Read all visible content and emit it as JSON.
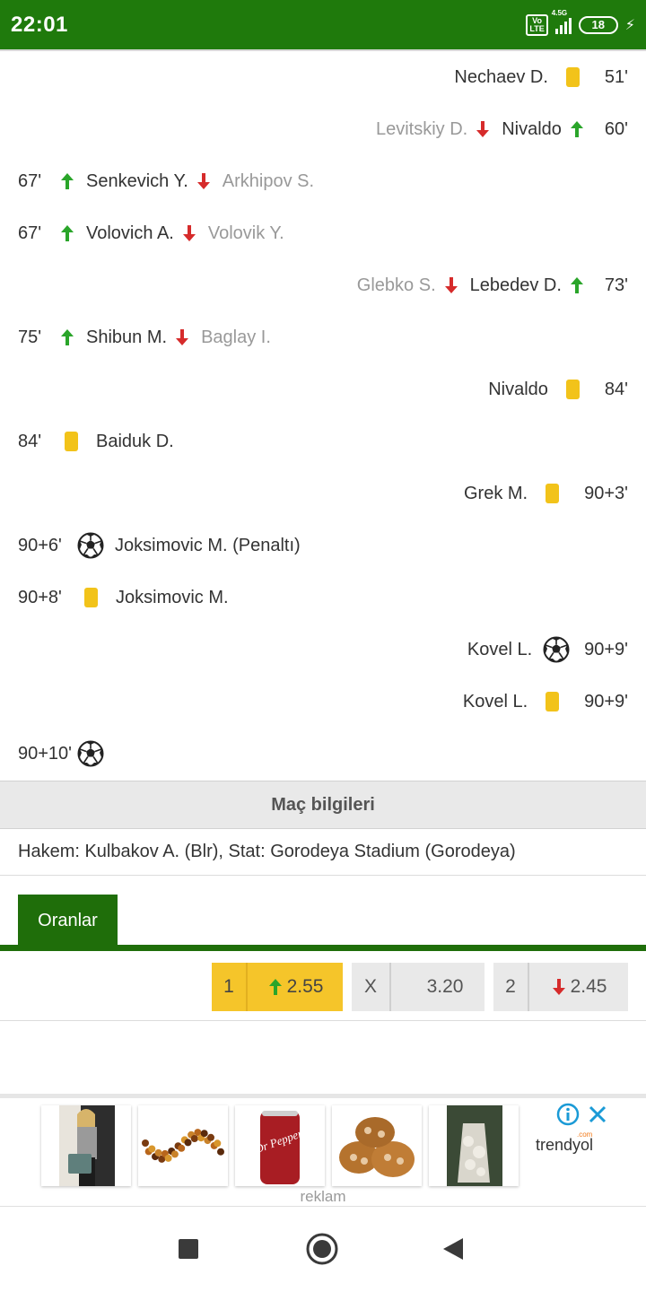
{
  "status_bar": {
    "time": "22:01",
    "volte": "Vo LTE",
    "network": "4.5G",
    "battery": "18",
    "accent_color": "#1f7a0c"
  },
  "events": [
    {
      "side": "right",
      "minute": "51'",
      "type": "yellow-card",
      "player": "Nechaev D."
    },
    {
      "side": "right",
      "minute": "60'",
      "type": "substitution",
      "player_in": "Nivaldo",
      "player_out": "Levitskiy D."
    },
    {
      "side": "left",
      "minute": "67'",
      "type": "substitution",
      "player_in": "Senkevich Y.",
      "player_out": "Arkhipov S."
    },
    {
      "side": "left",
      "minute": "67'",
      "type": "substitution",
      "player_in": "Volovich A.",
      "player_out": "Volovik Y."
    },
    {
      "side": "right",
      "minute": "73'",
      "type": "substitution",
      "player_in": "Lebedev D.",
      "player_out": "Glebko S."
    },
    {
      "side": "left",
      "minute": "75'",
      "type": "substitution",
      "player_in": "Shibun M.",
      "player_out": "Baglay I."
    },
    {
      "side": "right",
      "minute": "84'",
      "type": "yellow-card",
      "player": "Nivaldo"
    },
    {
      "side": "left",
      "minute": "84'",
      "type": "yellow-card",
      "player": "Baiduk D."
    },
    {
      "side": "right",
      "minute": "90+3'",
      "type": "yellow-card",
      "player": "Grek M."
    },
    {
      "side": "left",
      "minute": "90+6'",
      "type": "goal",
      "player": "Joksimovic M. (Penaltı)"
    },
    {
      "side": "left",
      "minute": "90+8'",
      "type": "yellow-card",
      "player": "Joksimovic M."
    },
    {
      "side": "right",
      "minute": "90+9'",
      "type": "goal",
      "player": "Kovel L."
    },
    {
      "side": "right",
      "minute": "90+9'",
      "type": "yellow-card",
      "player": "Kovel L."
    },
    {
      "side": "left",
      "minute": "90+10'",
      "type": "goal",
      "player": ""
    }
  ],
  "match_info": {
    "header": "Maç bilgileri",
    "details": "Hakem: Kulbakov A. (Blr), Stat: Gorodeya Stadium (Gorodeya)"
  },
  "odds": {
    "tab_label": "Oranlar",
    "items": [
      {
        "label": "1",
        "value": "2.55",
        "trend": "up",
        "highlighted": true
      },
      {
        "label": "X",
        "value": "3.20",
        "trend": "none",
        "highlighted": false
      },
      {
        "label": "2",
        "value": "2.45",
        "trend": "down",
        "highlighted": false
      }
    ]
  },
  "ad": {
    "label": "reklam",
    "brand": "trendyol",
    "brand_suffix": ".com",
    "products": [
      "woman-with-bag",
      "amber-necklace",
      "dr-pepper-can",
      "mushrooms",
      "mushroom-grow-bag"
    ],
    "dr_pepper_text": "Dr Pepper"
  },
  "colors": {
    "up_arrow": "#2aa52a",
    "down_arrow": "#d62b2b",
    "yellow_card": "#f2c31a",
    "odds_highlight": "#f5c52a"
  }
}
